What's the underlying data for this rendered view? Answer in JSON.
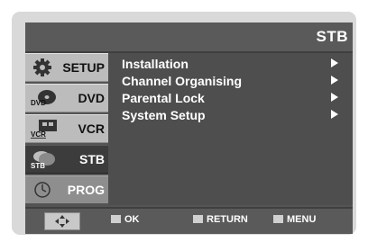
{
  "screen": {
    "title": "STB"
  },
  "sidebar": {
    "items": [
      {
        "label": "SETUP",
        "icon": "gear-icon"
      },
      {
        "label": "DVD",
        "icon": "dvd-icon",
        "badge": "DVD"
      },
      {
        "label": "VCR",
        "icon": "vcr-icon",
        "badge": "VCR"
      },
      {
        "label": "STB",
        "icon": "stb-icon",
        "badge": "STB",
        "selected": true
      },
      {
        "label": "PROG",
        "icon": "prog-clock-icon"
      }
    ]
  },
  "menu": {
    "items": [
      {
        "label": "Installation"
      },
      {
        "label": "Channel Organising"
      },
      {
        "label": "Parental Lock"
      },
      {
        "label": "System Setup"
      }
    ]
  },
  "footer": {
    "ok_label": "OK",
    "return_label": "RETURN",
    "menu_label": "MENU"
  },
  "colors": {
    "screen_bg": "#545454",
    "sidebar_item": "#bcbcbc",
    "sidebar_selected": "#3c3c3c",
    "text": "#ffffff"
  }
}
